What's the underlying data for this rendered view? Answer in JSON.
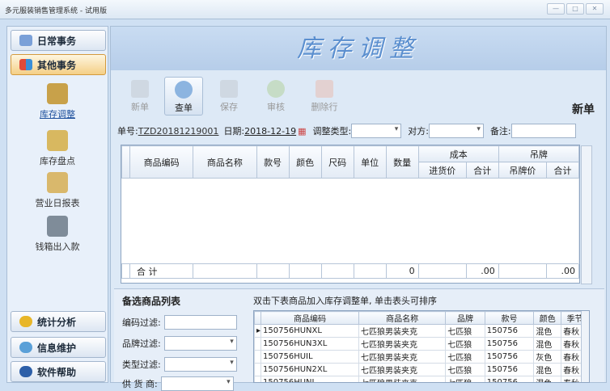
{
  "window": {
    "title": "多元服装销售管理系统 - 试用版"
  },
  "sidebar": {
    "daily": "日常事务",
    "other": "其他事务",
    "items": [
      {
        "label": "库存调整"
      },
      {
        "label": "库存盘点"
      },
      {
        "label": "营业日报表"
      },
      {
        "label": "钱箱出入款"
      }
    ],
    "stats": "统计分析",
    "info": "信息维护",
    "help": "软件帮助"
  },
  "banner": "库存调整",
  "toolbar": {
    "new": "新单",
    "query": "查单",
    "save": "保存",
    "audit": "审核",
    "delrow": "删除行"
  },
  "mode": "新单",
  "form": {
    "no_label": "单号:",
    "no": "TZD20181219001",
    "date_label": "日期:",
    "date": "2018-12-19",
    "type_label": "调整类型:",
    "party_label": "对方:",
    "note_label": "备注:"
  },
  "grid": {
    "headers": [
      "商品编码",
      "商品名称",
      "款号",
      "颜色",
      "尺码",
      "单位",
      "数量"
    ],
    "cost": "成本",
    "cost_sub": [
      "进货价",
      "合计"
    ],
    "tag": "吊牌",
    "tag_sub": [
      "吊牌价",
      "合计"
    ],
    "total_label": "合  计",
    "total_qty": "0",
    "total_cost": ".00",
    "total_tag": ".00"
  },
  "lower": {
    "title": "备选商品列表",
    "hint": "双击下表商品加入库存调整单, 单击表头可排序",
    "filters": [
      "编码过滤:",
      "品牌过滤:",
      "类型过滤:",
      "供 货 商:"
    ],
    "columns": [
      "商品编码",
      "商品名称",
      "品牌",
      "款号",
      "颜色",
      "季节"
    ],
    "rows": [
      [
        "150756HUNXL",
        "七匹狼男装夹克",
        "七匹狼",
        "150756",
        "混色",
        "春秋"
      ],
      [
        "150756HUN3XL",
        "七匹狼男装夹克",
        "七匹狼",
        "150756",
        "混色",
        "春秋"
      ],
      [
        "150756HUIL",
        "七匹狼男装夹克",
        "七匹狼",
        "150756",
        "灰色",
        "春秋"
      ],
      [
        "150756HUN2XL",
        "七匹狼男装夹克",
        "七匹狼",
        "150756",
        "混色",
        "春秋"
      ],
      [
        "150756HUNL",
        "七匹狼男装夹克",
        "七匹狼",
        "150756",
        "混色",
        "春秋"
      ]
    ]
  }
}
